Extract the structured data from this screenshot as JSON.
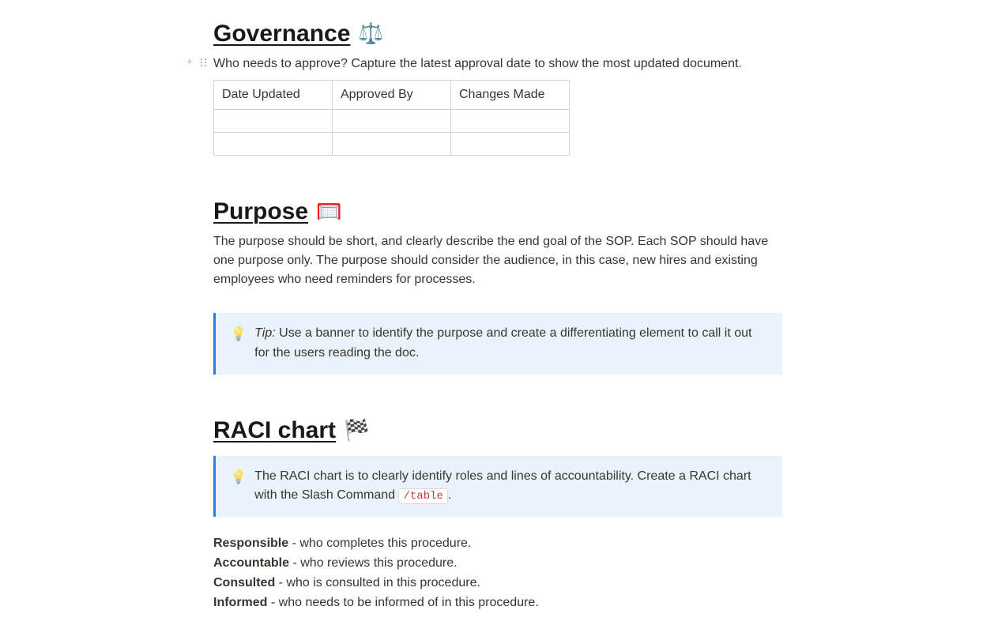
{
  "governance": {
    "title": "Governance",
    "emoji": "⚖️",
    "description": "Who needs to approve? Capture the latest approval date to show the most updated document.",
    "table": {
      "headers": [
        "Date Updated",
        "Approved By",
        "Changes Made"
      ],
      "rows": [
        [
          "",
          "",
          ""
        ],
        [
          "",
          "",
          ""
        ]
      ]
    }
  },
  "purpose": {
    "title": "Purpose",
    "emoji": "🥅",
    "body": "The purpose should be short, and clearly describe the end goal of the SOP. Each SOP should have one purpose only. The purpose should consider the audience, in this case, new hires and existing employees who need reminders for processes.",
    "tip": {
      "bulb": "💡",
      "label": "Tip:",
      "text": " Use a banner to identify the purpose and create a differentiating element to call it out for the users reading the doc."
    }
  },
  "raci": {
    "title": "RACI chart",
    "emoji": "🏁",
    "callout": {
      "bulb": "💡",
      "text_before": "The RACI chart is to clearly identify roles and lines of accountability. Create a RACI chart with the Slash Command ",
      "code": "/table",
      "text_after": "."
    },
    "items": [
      {
        "term": "Responsible",
        "desc": " - who completes this procedure."
      },
      {
        "term": "Accountable",
        "desc": " - who reviews this procedure."
      },
      {
        "term": "Consulted",
        "desc": " - who is consulted in this procedure."
      },
      {
        "term": "Informed",
        "desc": " - who needs to be informed of in this procedure."
      }
    ]
  }
}
